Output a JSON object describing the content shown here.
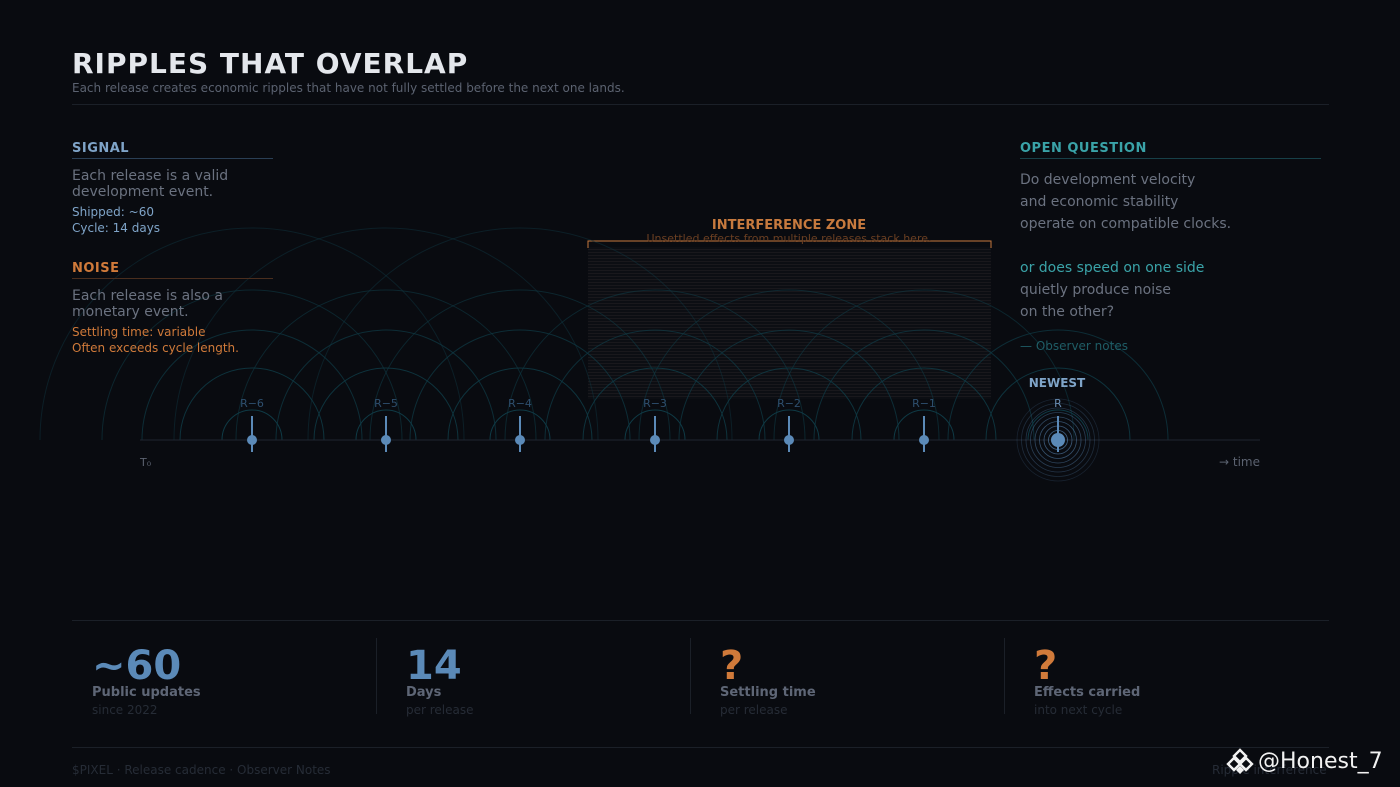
{
  "header": {
    "title": "RIPPLES THAT OVERLAP",
    "subtitle": "Each release creates economic ripples that have not fully settled before the next one lands."
  },
  "signal": {
    "heading": "SIGNAL",
    "text_line1": "Each release is a valid",
    "text_line2": "development event.",
    "shipped": "Shipped: ~60",
    "cycle": "Cycle: 14 days"
  },
  "noise": {
    "heading": "NOISE",
    "text_line1": "Each release is also a",
    "text_line2": "monetary event.",
    "settling": "Settling time: variable",
    "exceeds": "Often exceeds cycle length."
  },
  "open_question": {
    "heading": "OPEN QUESTION",
    "line1": "Do development velocity",
    "line2": "and economic stability",
    "line3": "operate on compatible clocks.",
    "line4": "or does speed on one side",
    "line5": "quietly produce noise",
    "line6": "on the other?",
    "signature": "— Observer notes"
  },
  "diagram": {
    "zone_title": "INTERFERENCE ZONE",
    "zone_subtitle": "Unsettled effects from multiple releases stack here.",
    "newest_label": "NEWEST",
    "axis_start": "T₀",
    "axis_end": "→ time",
    "releases": [
      "R−6",
      "R−5",
      "R−4",
      "R−3",
      "R−2",
      "R−1",
      "R"
    ],
    "colors": {
      "ripple": "#0f3a45",
      "release": "#5b8ab8",
      "zone": "#c77a3e",
      "signal": "#7fa4c8",
      "teal": "#3aa3a8"
    }
  },
  "stats": [
    {
      "value": "~60",
      "label": "Public updates",
      "sub": "since 2022",
      "color": "#5b8ab8"
    },
    {
      "value": "14",
      "label": "Days",
      "sub": "per release",
      "color": "#5b8ab8"
    },
    {
      "value": "?",
      "label": "Settling time",
      "sub": "per release",
      "color": "#d07a3a"
    },
    {
      "value": "?",
      "label": "Effects carried",
      "sub": "into next cycle",
      "color": "#d07a3a"
    }
  ],
  "footer": {
    "left": "$PIXEL · Release cadence · Observer Notes",
    "right": "Ripple interference"
  },
  "watermark": {
    "handle": "@Honest_7",
    "icon": "binance-diamond-icon"
  }
}
